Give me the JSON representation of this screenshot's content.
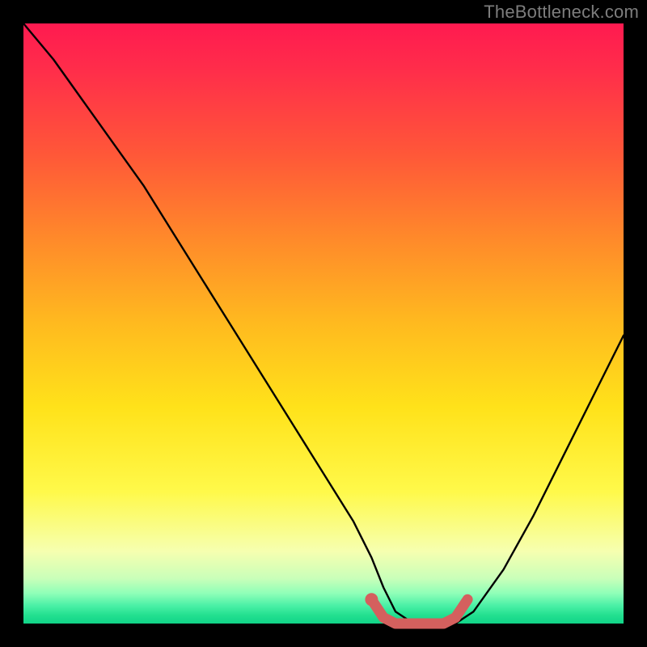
{
  "watermark": "TheBottleneck.com",
  "colors": {
    "background": "#000000",
    "curve": "#000000",
    "marker": "#d4605e",
    "gradient_top": "#ff1a50",
    "gradient_bottom": "#11d488"
  },
  "chart_data": {
    "type": "line",
    "title": "",
    "xlabel": "",
    "ylabel": "",
    "xlim": [
      0,
      100
    ],
    "ylim": [
      0,
      100
    ],
    "series": [
      {
        "name": "bottleneck-curve",
        "x": [
          0,
          5,
          10,
          15,
          20,
          25,
          30,
          35,
          40,
          45,
          50,
          55,
          58,
          60,
          62,
          65,
          68,
          70,
          72,
          75,
          80,
          85,
          90,
          95,
          100
        ],
        "y": [
          100,
          94,
          87,
          80,
          73,
          65,
          57,
          49,
          41,
          33,
          25,
          17,
          11,
          6,
          2,
          0,
          0,
          0,
          0,
          2,
          9,
          18,
          28,
          38,
          48
        ]
      }
    ],
    "annotations": [
      {
        "name": "optimal-zone-marker",
        "type": "path",
        "x": [
          58,
          60,
          62,
          65,
          68,
          70,
          72,
          74
        ],
        "y": [
          4,
          1,
          0,
          0,
          0,
          0,
          1,
          4
        ]
      },
      {
        "name": "optimal-start-dot",
        "type": "point",
        "x": 58,
        "y": 4
      }
    ]
  }
}
